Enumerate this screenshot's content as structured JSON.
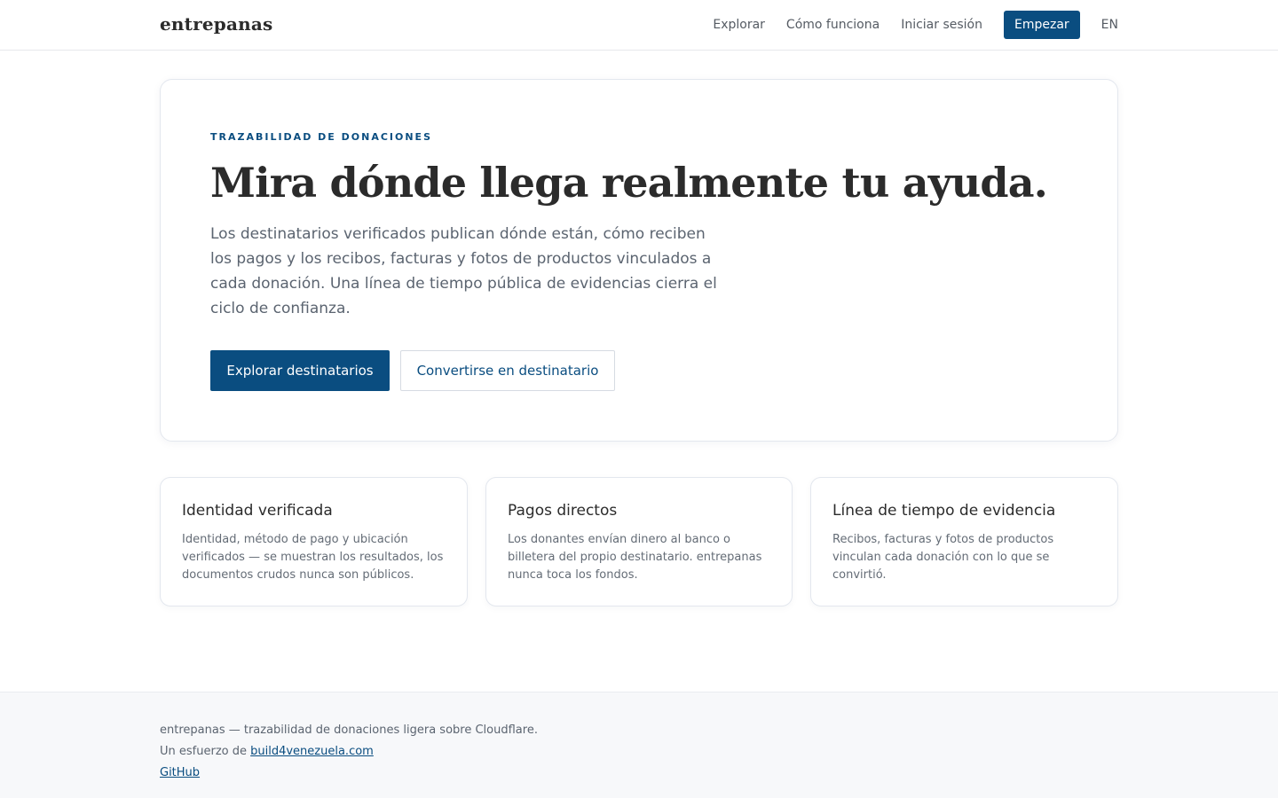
{
  "header": {
    "brand": "entrepanas",
    "nav": {
      "explore": "Explorar",
      "how_it_works": "Cómo funciona",
      "sign_in": "Iniciar sesión",
      "get_started": "Empezar",
      "language": "EN"
    }
  },
  "hero": {
    "eyebrow": "TRAZABILIDAD DE DONACIONES",
    "headline": "Mira dónde llega realmente tu ayuda.",
    "lede": "Los destinatarios verificados publican dónde están, cómo reciben los pagos y los recibos, facturas y fotos de productos vinculados a cada donación. Una línea de tiempo pública de evidencias cierra el ciclo de confianza.",
    "primary_button": "Explorar destinatarios",
    "secondary_button": "Convertirse en destinatario"
  },
  "features": [
    {
      "title": "Identidad verificada",
      "body": "Identidad, método de pago y ubicación verificados — se muestran los resultados, los documentos crudos nunca son públicos."
    },
    {
      "title": "Pagos directos",
      "body": "Los donantes envían dinero al banco o billetera del propio destinatario. entrepanas nunca toca los fondos."
    },
    {
      "title": "Línea de tiempo de evidencia",
      "body": "Recibos, facturas y fotos de productos vinculan cada donación con lo que se convirtió."
    }
  ],
  "footer": {
    "tagline": "entrepanas — trazabilidad de donaciones ligera sobre Cloudflare.",
    "effort_prefix": "Un esfuerzo de",
    "effort_link": "build4venezuela.com",
    "github": "GitHub"
  },
  "colors": {
    "accent": "#0a4d80",
    "text": "#2b2b2b",
    "muted": "#5b6470",
    "border": "#e3e7ee",
    "footer_bg": "#f7f8fa"
  }
}
